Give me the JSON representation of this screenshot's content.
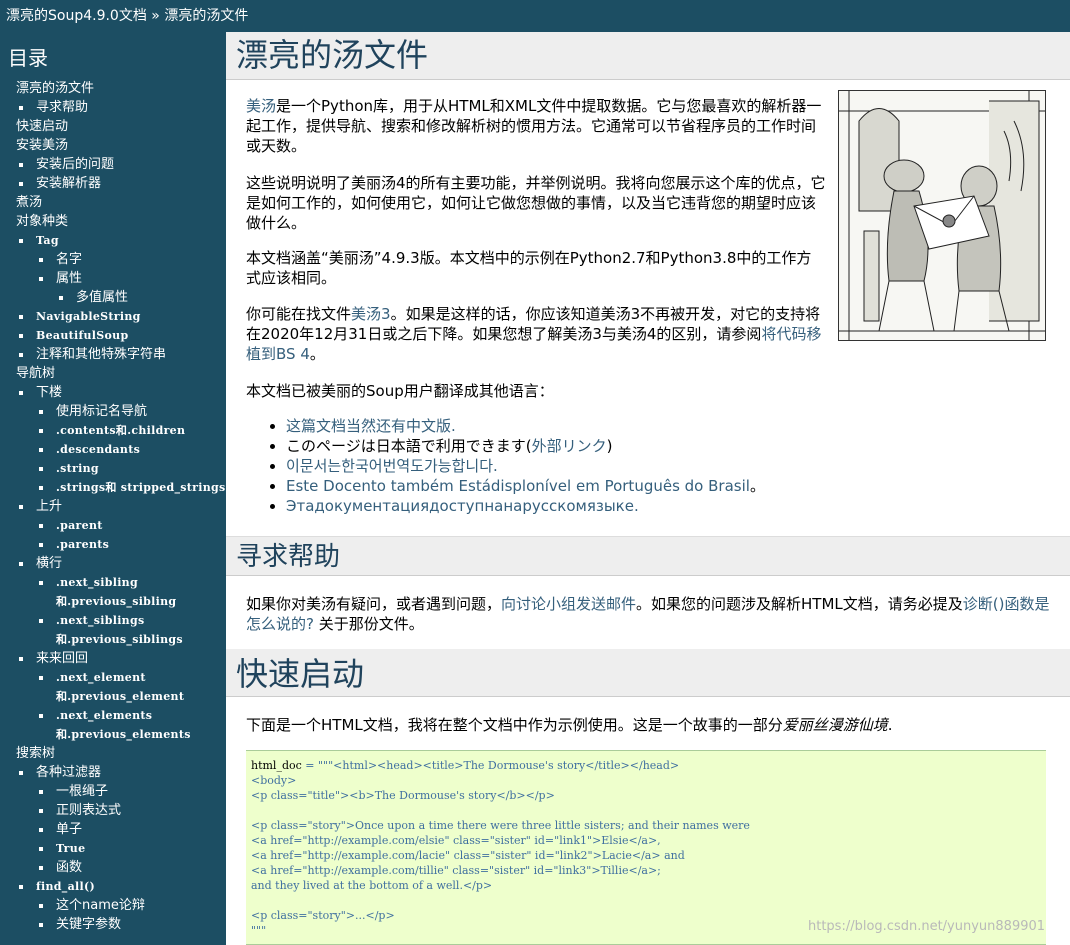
{
  "header": {
    "breadcrumb_root": "漂亮的Soup4.9.0文档",
    "breadcrumb_sep": "»",
    "breadcrumb_current": "漂亮的汤文件"
  },
  "sidebar": {
    "title": "目录",
    "toc": [
      {
        "label": "漂亮的汤文件",
        "level": 1
      },
      {
        "label": "寻求帮助",
        "level": 2
      },
      {
        "label": "快速启动",
        "level": 1
      },
      {
        "label": "安装美汤",
        "level": 1
      },
      {
        "label": "安装后的问题",
        "level": 2
      },
      {
        "label": "安装解析器",
        "level": 2
      },
      {
        "label": "煮汤",
        "level": 1
      },
      {
        "label": "对象种类",
        "level": 1
      },
      {
        "label": "Tag",
        "level": 2,
        "mono": true
      },
      {
        "label": "名字",
        "level": 3
      },
      {
        "label": "属性",
        "level": 3
      },
      {
        "label": "多值属性",
        "level": 4
      },
      {
        "label": "NavigableString",
        "level": 2,
        "mono": true
      },
      {
        "label": "BeautifulSoup",
        "level": 2,
        "mono": true
      },
      {
        "label": "注释和其他特殊字符串",
        "level": 2
      },
      {
        "label": "导航树",
        "level": 1
      },
      {
        "label": "下楼",
        "level": 2
      },
      {
        "label": "使用标记名导航",
        "level": 3
      },
      {
        "label": ".contents和.children",
        "level": 3,
        "mono": true
      },
      {
        "label": ".descendants",
        "level": 3,
        "mono": true
      },
      {
        "label": ".string",
        "level": 3,
        "mono": true
      },
      {
        "label": ".strings和 stripped_strings",
        "level": 3,
        "mono": true
      },
      {
        "label": "上升",
        "level": 2
      },
      {
        "label": ".parent",
        "level": 3,
        "mono": true
      },
      {
        "label": ".parents",
        "level": 3,
        "mono": true
      },
      {
        "label": "横行",
        "level": 2
      },
      {
        "label": ".next_sibling 和.previous_sibling",
        "level": 3,
        "mono": true
      },
      {
        "label": ".next_siblings 和.previous_siblings",
        "level": 3,
        "mono": true
      },
      {
        "label": "来来回回",
        "level": 2
      },
      {
        "label": ".next_element 和.previous_element",
        "level": 3,
        "mono": true
      },
      {
        "label": ".next_elements 和.previous_elements",
        "level": 3,
        "mono": true
      },
      {
        "label": "搜索树",
        "level": 1
      },
      {
        "label": "各种过滤器",
        "level": 2
      },
      {
        "label": "一根绳子",
        "level": 3
      },
      {
        "label": "正则表达式",
        "level": 3
      },
      {
        "label": "单子",
        "level": 3
      },
      {
        "label": "True",
        "level": 3,
        "mono": true
      },
      {
        "label": "函数",
        "level": 3
      },
      {
        "label": "find_all()",
        "level": 2,
        "mono": true
      },
      {
        "label": "这个name论辩",
        "level": 3
      },
      {
        "label": "关键字参数",
        "level": 3
      }
    ]
  },
  "main": {
    "title": "漂亮的汤文件",
    "intro": {
      "link": "美汤",
      "text": "是一个Python库，用于从HTML和XML文件中提取数据。它与您最喜欢的解析器一起工作，提供导航、搜索和修改解析树的惯用方法。它通常可以节省程序员的工作时间或天数。"
    },
    "para2": "这些说明说明了美丽汤4的所有主要功能，并举例说明。我将向您展示这个库的优点，它是如何工作的，如何使用它，如何让它做您想做的事情，以及当它违背您的期望时应该做什么。",
    "para3": "本文档涵盖“美丽汤”4.9.3版。本文档中的示例在Python2.7和Python3.8中的工作方式应该相同。",
    "para4": {
      "t1": "你可能在找文件",
      "link1": "美汤3",
      "t2": "。如果是这样的话，你应该知道美汤3不再被开发，对它的支持将在2020年12月31日或之后下降。如果您想了解美汤3与美汤4的区别，请参阅",
      "link2": "将代码移植到BS 4",
      "t3": "。"
    },
    "para5": "本文档已被美丽的Soup用户翻译成其他语言：",
    "languages": [
      {
        "link": "这篇文档当然还有中文版.",
        "text": ""
      },
      {
        "text": "このページは日本語で利用できます(",
        "link": "外部リンク",
        "after": ")"
      },
      {
        "link": "이문서는한국어번역도가능합니다.",
        "text": ""
      },
      {
        "link": "Este Docento também Estádisplonível em Português do Brasil",
        "text": "",
        "after": "。"
      },
      {
        "link": "Этадокументациядоступнанарусскомязыке.",
        "text": ""
      }
    ],
    "help": {
      "title": "寻求帮助",
      "t1": "如果你对美汤有疑问，或者遇到问题，",
      "link1": "向讨论小组发送邮件",
      "t2": "。如果您的问题涉及解析HTML文档，请务必提及",
      "link2": "诊断()函数是怎么说的?",
      "t3": " 关于那份文件。"
    },
    "quickstart": {
      "title": "快速启动",
      "text": "下面是一个HTML文档，我将在整个文档中作为示例使用。这是一个故事的一部分",
      "italic": "爱丽丝漫游仙境",
      "end": "."
    },
    "code": {
      "var": "html_doc",
      "lines": [
        " = \"\"\"<html><head><title>The Dormouse's story</title></head>",
        "<body>",
        "<p class=\"title\"><b>The Dormouse's story</b></p>",
        "",
        "<p class=\"story\">Once upon a time there were three little sisters; and their names were",
        "<a href=\"http://example.com/elsie\" class=\"sister\" id=\"link1\">Elsie</a>,",
        "<a href=\"http://example.com/lacie\" class=\"sister\" id=\"link2\">Lacie</a> and",
        "<a href=\"http://example.com/tillie\" class=\"sister\" id=\"link3\">Tillie</a>;",
        "and they lived at the bottom of a well.</p>",
        "",
        "<p class=\"story\">...</p>",
        "\"\"\""
      ]
    }
  },
  "watermark": "https://blog.csdn.net/yunyun889901",
  "colors": {
    "sidebar_bg": "#1c4e63",
    "link": "#355f7c",
    "heading": "#20435c",
    "code_bg": "#eeffcc"
  }
}
